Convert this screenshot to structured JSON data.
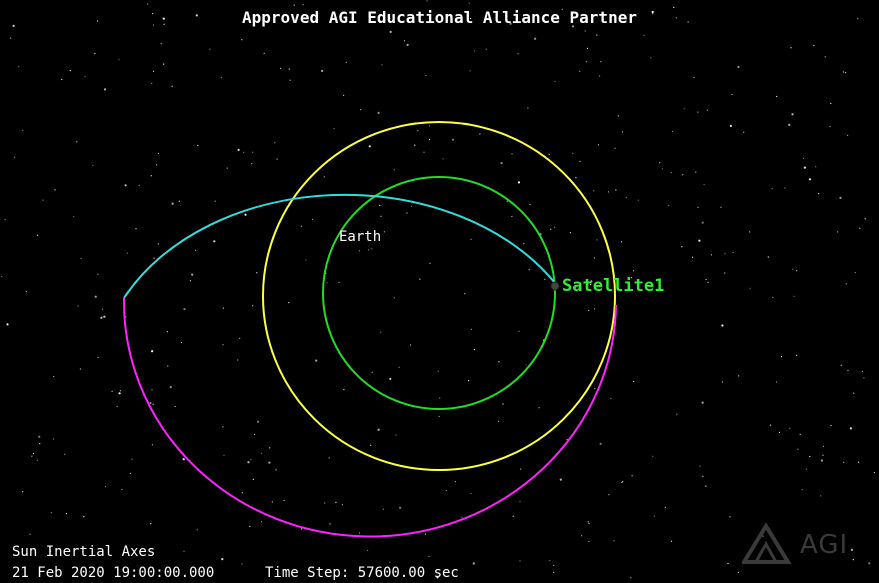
{
  "banner": "Approved AGI Educational Alliance Partner",
  "objects": {
    "earth_label": "Earth",
    "satellite_label": "Satellite1"
  },
  "status": {
    "axes": "Sun Inertial Axes",
    "epoch": "21 Feb 2020 19:00:00.000",
    "time_step": "Time Step: 57600.00 sec"
  },
  "logo": {
    "text": "AGI"
  },
  "colors": {
    "background": "#000000",
    "inner_orbit": "#22dd22",
    "middle_orbit": "#ffff44",
    "transfer_orbit_upper": "#33dddd",
    "transfer_orbit_lower": "#ff22ff",
    "satellite_label": "#33ee33",
    "text": "#ffffff"
  }
}
